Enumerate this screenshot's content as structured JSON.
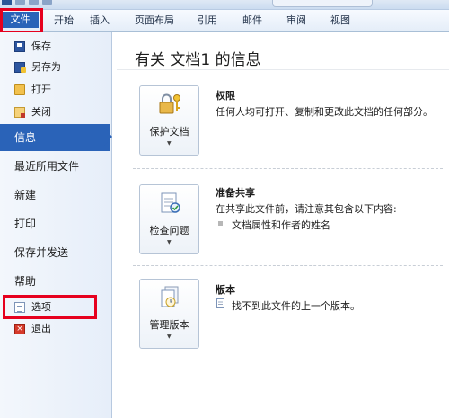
{
  "ribbon": {
    "tabs": [
      "文件",
      "开始",
      "插入",
      "页面布局",
      "引用",
      "邮件",
      "审阅",
      "视图"
    ]
  },
  "nav": {
    "commands_top": [
      "保存",
      "另存为",
      "打开",
      "关闭"
    ],
    "tabs": [
      "信息",
      "最近所用文件",
      "新建",
      "打印",
      "保存并发送",
      "帮助"
    ],
    "commands_bottom": [
      "选项",
      "退出"
    ],
    "selected": "信息"
  },
  "info": {
    "title": "有关 文档1 的信息",
    "sections": [
      {
        "button": "保护文档",
        "button_icon": "lock-keys-icon",
        "heading": "权限",
        "lines": [
          "任何人均可打开、复制和更改此文档的任何部分。"
        ]
      },
      {
        "button": "检查问题",
        "button_icon": "checklist-icon",
        "heading": "准备共享",
        "lines": [
          "在共享此文件前，请注意其包含以下内容:"
        ],
        "bullets": [
          "文档属性和作者的姓名"
        ]
      },
      {
        "button": "管理版本",
        "button_icon": "document-versions-icon",
        "heading": "版本",
        "lines": [
          "找不到此文件的上一个版本。"
        ]
      }
    ]
  },
  "colors": {
    "accent": "#2a63b8",
    "highlight_box": "#e6001e"
  }
}
